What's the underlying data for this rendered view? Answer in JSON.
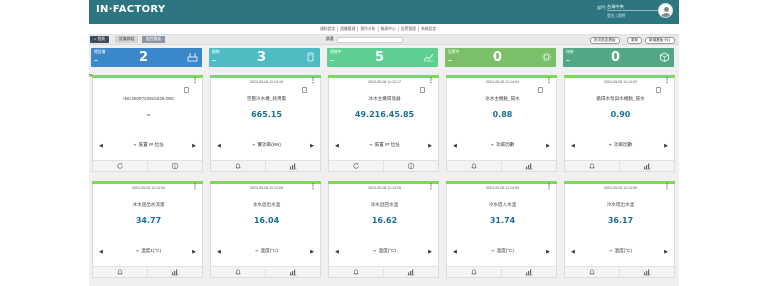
{
  "app": {
    "logo": "IN·FACTORY"
  },
  "user": {
    "label": "部門",
    "dept": "台灣中央",
    "sub": "登出 | 說明"
  },
  "topnav": [
    "通知設定",
    "設備管理",
    "運作分析",
    "報表中心",
    "告警管理",
    "系統設定"
  ],
  "breadcrumb": {
    "home": "首頁",
    "items": [
      "設備群組",
      "監控看板"
    ],
    "filter_label": "篩選",
    "right_buttons": [
      "批次設定看板",
      "更新",
      "新增看板卡片"
    ]
  },
  "summary": [
    {
      "title": "總設備",
      "dots": "...",
      "value": "2",
      "color": "#3a87c9",
      "icon": "router-icon"
    },
    {
      "title": "離線",
      "dots": "...",
      "value": "3",
      "color": "#4fbcc4",
      "icon": "device-icon"
    },
    {
      "title": "連線中",
      "dots": "...",
      "value": "5",
      "color": "#5dcf92",
      "icon": "chart-up-icon"
    },
    {
      "title": "告警中",
      "dots": "...",
      "value": "0",
      "color": "#7bbf6a",
      "icon": "settings-icon"
    },
    {
      "title": "待修",
      "dots": "...",
      "value": "0",
      "color": "#52a884",
      "icon": "cube-icon"
    }
  ],
  "cards": [
    {
      "time": "",
      "name": "INC4000732915325-000",
      "value": "-",
      "label": "裝置 IP 位址",
      "icons": [
        "refresh-icon",
        "info-icon"
      ],
      "dev": "router"
    },
    {
      "time": "2024-05-06 11:14:16",
      "name": "空壓冷水機_耗用電",
      "value": "665.15",
      "label": "實功率(kW)",
      "icons": [
        "bell-icon",
        "chart-icon"
      ],
      "dev": "box"
    },
    {
      "time": "2024-05-06 11:12:17",
      "name": "冰水主機環境器",
      "value": "49.216.45.85",
      "label": "裝置 IP 位址",
      "icons": [
        "refresh-icon",
        "info-icon"
      ],
      "dev": "router"
    },
    {
      "time": "2024-05-06 11:14:04",
      "name": "冰水主機動_揚水",
      "value": "0.88",
      "label": "功率因數",
      "icons": [
        "bell-icon",
        "chart-icon"
      ],
      "dev": "box"
    },
    {
      "time": "2024-05-06 11:14:03",
      "name": "循環水泵與水機動_揚水",
      "value": "0.90",
      "label": "功率因數",
      "icons": [
        "bell-icon",
        "chart-icon"
      ],
      "dev": "box"
    },
    {
      "time": "2024-05-06 11:14:04",
      "name": "冰水迴出水流量",
      "value": "34.77",
      "label": "溫度1(°C)",
      "icons": [
        "bell-icon",
        "chart-icon"
      ],
      "dev": ""
    },
    {
      "time": "2024-05-06 11:14:05",
      "name": "冰水迴出水溫",
      "value": "16.04",
      "label": "溫度(°C)",
      "icons": [
        "bell-icon",
        "chart-icon"
      ],
      "dev": ""
    },
    {
      "time": "2024-05-06 11:14:05",
      "name": "冰水迴回水溫",
      "value": "16.62",
      "label": "溫度(°C)",
      "icons": [
        "bell-icon",
        "chart-icon"
      ],
      "dev": ""
    },
    {
      "time": "2024-05-06 11:14:05",
      "name": "冷水塔入水溫",
      "value": "31.74",
      "label": "溫度(°C)",
      "icons": [
        "bell-icon",
        "chart-icon"
      ],
      "dev": ""
    },
    {
      "time": "2024-05-06 11:14:05",
      "name": "冷水塔出水溫",
      "value": "36.17",
      "label": "溫度(°C)",
      "icons": [
        "bell-icon",
        "chart-icon"
      ],
      "dev": ""
    }
  ],
  "colors": {
    "header": "#2d7580",
    "card_top": "#7ed957",
    "value": "#1b6f9b"
  }
}
